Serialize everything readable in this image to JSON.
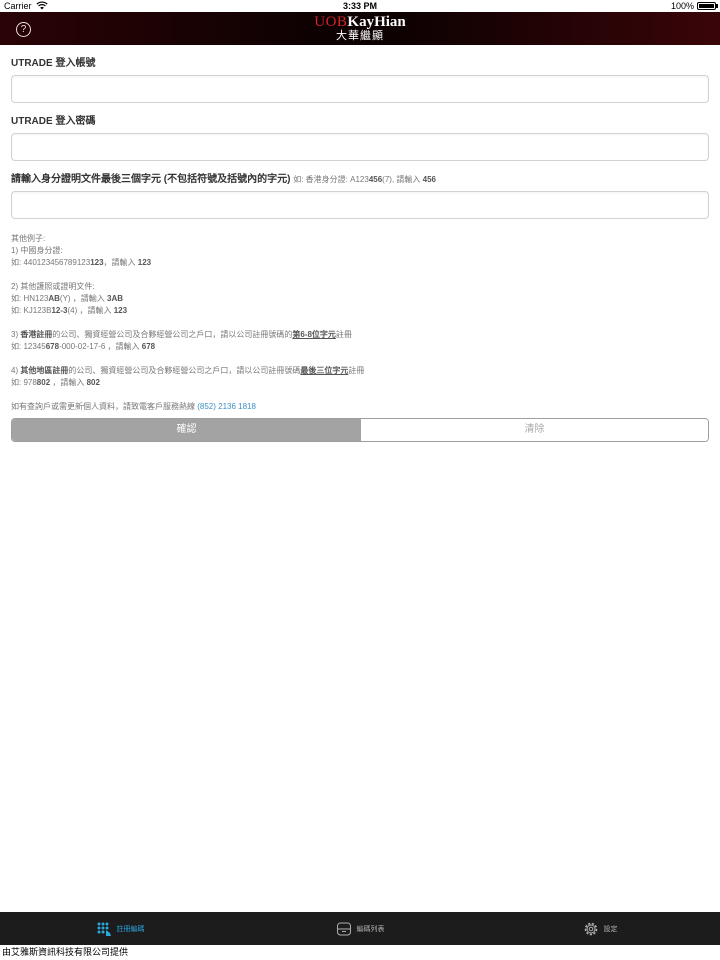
{
  "status_bar": {
    "carrier": "Carrier",
    "time": "3:33 PM",
    "battery": "100%"
  },
  "header": {
    "brand_latin_1": "UOB",
    "brand_latin_2": "KayHian",
    "brand_chinese": "大華繼顯",
    "help_glyph": "?",
    "colors": {
      "brand_red": "#d2232a",
      "bar_dark": "#0d0102"
    }
  },
  "form": {
    "account_label": "UTRADE 登入帳號",
    "password_label": "UTRADE 登入密碼",
    "id_label": "請輸入身分證明文件最後三個字元 (不包括符號及括號內的字元)",
    "id_hint_pre": "如: 香港身分證: A123",
    "id_hint_bold": "456",
    "id_hint_mid": "(7), 請輸入 ",
    "id_hint_bold2": "456"
  },
  "examples": {
    "title": "其他例子:",
    "ex1_title": "1) 中國身分證:",
    "ex1_pre": "如: 440123456789123",
    "ex1_bold": "123",
    "ex1_mid": "，請輸入 ",
    "ex1_bold2": "123",
    "ex2_title": "2) 其他護照或證明文件:",
    "ex2a_pre": "如: HN123",
    "ex2a_bold": "AB",
    "ex2a_mid": "(Y) ，請輸入 ",
    "ex2a_bold2": "3AB",
    "ex2b_pre": "如: KJ123B",
    "ex2b_bold": "12-3",
    "ex2b_mid": "(4) ，請輸入 ",
    "ex2b_bold2": "123",
    "ex3_num": "3) ",
    "ex3_bold": "香港註冊",
    "ex3_mid": "的公司、獨資經營公司及合夥經營公司之戶口，請以公司註冊號碼的",
    "ex3_under": "第6-8位字元",
    "ex3_end": "註冊",
    "ex3_line2_pre": "如: 12345",
    "ex3_line2_bold": "678",
    "ex3_line2_mid": "-000-02-17-6 ，請輸入 ",
    "ex3_line2_bold2": "678",
    "ex4_num": "4) ",
    "ex4_bold": "其他地區註冊",
    "ex4_mid": "的公司、獨資經營公司及合夥經營公司之戶口，請以公司註冊號碼",
    "ex4_under": "最後三位字元",
    "ex4_end": "註冊",
    "ex4_line2_pre": "如: 978",
    "ex4_line2_bold": "802",
    "ex4_line2_mid": " ，請輸入 ",
    "ex4_line2_bold2": "802"
  },
  "contact": {
    "text": "如有查詢戶或需更新個人資料，請致電客戶服務熱線 ",
    "phone": "(852) 2136 1818"
  },
  "buttons": {
    "confirm": "確認",
    "clear": "清除"
  },
  "tabs": [
    {
      "label": "註冊編碼",
      "icon": "keypad-icon",
      "active": true
    },
    {
      "label": "編碼列表",
      "icon": "safe-icon",
      "active": false
    },
    {
      "label": "設定",
      "icon": "gear-icon",
      "active": false
    }
  ],
  "footer": "由艾雅斯資訊科技有限公司提供",
  "colors": {
    "accent_blue": "#2aa6e0",
    "link_blue": "#3b8fc8",
    "confirm_gray": "#a3a3a3"
  }
}
